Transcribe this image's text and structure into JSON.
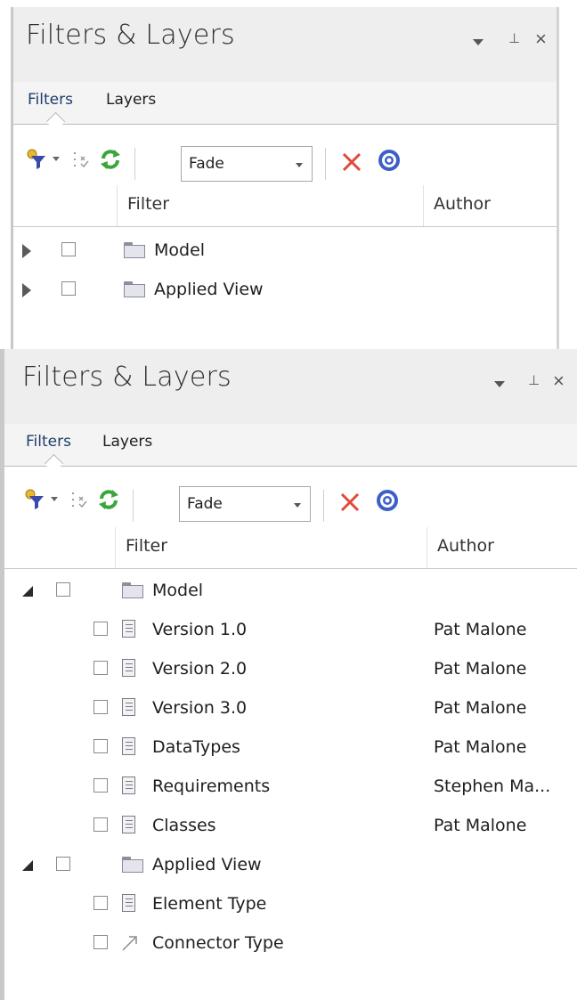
{
  "panel_top": {
    "title": "Filters & Layers",
    "tabs": [
      "Filters",
      "Layers"
    ],
    "toolbar": {
      "mode_value": "Fade"
    },
    "columns": {
      "filter": "Filter",
      "author": "Author"
    },
    "rows": [
      {
        "label": "Model",
        "expanded": false
      },
      {
        "label": "Applied View",
        "expanded": false
      }
    ]
  },
  "panel_bottom": {
    "title": "Filters & Layers",
    "tabs": [
      "Filters",
      "Layers"
    ],
    "toolbar": {
      "mode_value": "Fade"
    },
    "columns": {
      "filter": "Filter",
      "author": "Author"
    },
    "model_folder": {
      "label": "Model",
      "expanded": true
    },
    "model_items": [
      {
        "label": "Version 1.0",
        "author": "Pat Malone"
      },
      {
        "label": "Version 2.0",
        "author": "Pat Malone"
      },
      {
        "label": "Version 3.0",
        "author": "Pat Malone"
      },
      {
        "label": "DataTypes",
        "author": "Pat Malone"
      },
      {
        "label": "Requirements",
        "author": "Stephen Ma..."
      },
      {
        "label": "Classes",
        "author": "Pat Malone"
      }
    ],
    "applied_folder": {
      "label": "Applied View",
      "expanded": true
    },
    "applied_items": [
      {
        "label": "Element Type",
        "icon": "document-icon"
      },
      {
        "label": "Connector Type",
        "icon": "connector-icon"
      }
    ]
  },
  "icons": [
    "filter-add-icon",
    "dropdown-arrow-icon",
    "checklist-icon",
    "refresh-icon",
    "delete-icon",
    "help-icon",
    "pin-icon",
    "close-icon"
  ],
  "colors": {
    "delete": "#e0493b",
    "help": "#3d5fc8",
    "refresh": "#3aa53a",
    "filter": "#e2b12c"
  }
}
